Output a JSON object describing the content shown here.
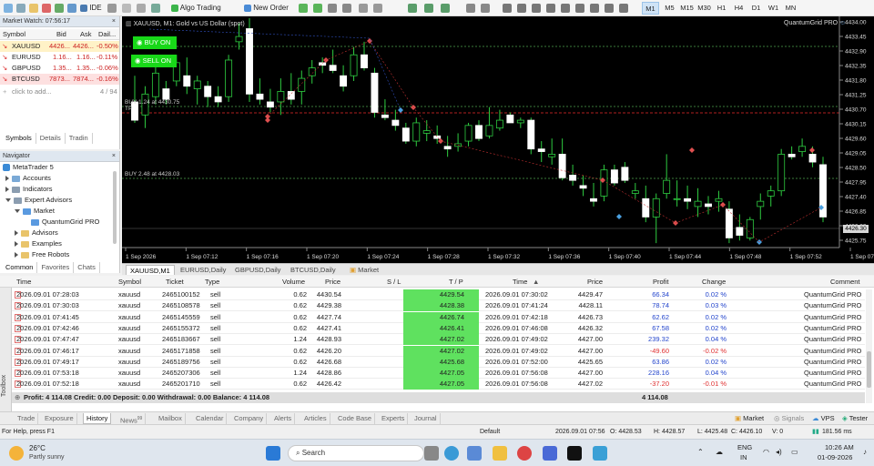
{
  "toolbar": {
    "ide": "IDE",
    "algo": "Algo Trading",
    "new_order": "New Order",
    "timeframes": [
      "M1",
      "M5",
      "M15",
      "M30",
      "H1",
      "H4",
      "D1",
      "W1",
      "MN"
    ],
    "active_tf": "M1"
  },
  "market_watch": {
    "title": "Market Watch: 07:56:17",
    "cols": [
      "Symbol",
      "Bid",
      "Ask",
      "Dail..."
    ],
    "rows": [
      {
        "sym": "XAUUSD",
        "bid": "4426...",
        "ask": "4426...",
        "chg": "-0.50%"
      },
      {
        "sym": "EURUSD",
        "bid": "1.16...",
        "ask": "1.16...",
        "chg": "-0.11%"
      },
      {
        "sym": "GBPUSD",
        "bid": "1.35...",
        "ask": "1.35...",
        "chg": "-0.06%"
      },
      {
        "sym": "BTCUSD",
        "bid": "7873...",
        "ask": "7874...",
        "chg": "-0.16%"
      }
    ],
    "add": "click to add...",
    "count": "4 / 94",
    "tabs": [
      "Symbols",
      "Details",
      "Tradin"
    ]
  },
  "navigator": {
    "title": "Navigator",
    "items": [
      "MetaTrader 5",
      "Accounts",
      "Indicators",
      "Expert Advisors",
      "Market",
      "QuantumGrid PRO",
      "Advisors",
      "Examples",
      "Free Robots"
    ],
    "tabs": [
      "Common",
      "Favorites",
      "Chats"
    ]
  },
  "chart": {
    "title": "XAUUSD, M1:  Gold vs US Dollar (spot)",
    "ea": "QuantumGrid PRO",
    "buy_on": "BUY ON",
    "sell_on": "SELL ON",
    "line_buy1": "BUY 1.24 at 4430.75",
    "line_tp": "TP",
    "line_buy2": "BUY 2.48 at 4428.03",
    "price_tag": "4426.30",
    "yticks": [
      "4434.00",
      "4433.45",
      "4432.90",
      "4432.35",
      "4431.80",
      "4431.25",
      "4430.70",
      "4430.15",
      "4429.60",
      "4429.05",
      "4428.50",
      "4427.95",
      "4427.40",
      "4426.85",
      "4426.30",
      "4425.75"
    ],
    "xticks": [
      "1 Sep 2026",
      "1 Sep 07:12",
      "1 Sep 07:16",
      "1 Sep 07:20",
      "1 Sep 07:24",
      "1 Sep 07:28",
      "1 Sep 07:32",
      "1 Sep 07:36",
      "1 Sep 07:40",
      "1 Sep 07:44",
      "1 Sep 07:48",
      "1 Sep 07:52",
      "1 Sep 07:56"
    ],
    "tabs": [
      "XAUUSD,M1",
      "EURUSD,Daily",
      "GBPUSD,Daily",
      "BTCUSD,Daily",
      "Market"
    ]
  },
  "chart_data": {
    "type": "candlestick",
    "ylim": [
      4425.5,
      4434.2
    ],
    "candles": [
      [
        4431.0,
        4432.0,
        4430.2,
        4430.3
      ],
      [
        4430.5,
        4431.6,
        4430.0,
        4431.3
      ],
      [
        4431.2,
        4432.5,
        4430.9,
        4432.1
      ],
      [
        4431.5,
        4431.8,
        4430.9,
        4431.1
      ],
      [
        4431.8,
        4432.8,
        4431.6,
        4432.5
      ],
      [
        4432.0,
        4432.7,
        4431.3,
        4431.6
      ],
      [
        4431.5,
        4432.0,
        4430.9,
        4431.8
      ],
      [
        4431.6,
        4431.8,
        4430.8,
        4431.2
      ],
      [
        4431.2,
        4431.6,
        4430.8,
        4431.0
      ],
      [
        4431.2,
        4432.8,
        4431.0,
        4432.6
      ],
      [
        4433.3,
        4434.0,
        4433.0,
        4433.5
      ],
      [
        4433.8,
        4434.2,
        4431.0,
        4431.3
      ],
      [
        4431.3,
        4431.9,
        4430.9,
        4431.1
      ],
      [
        4431.0,
        4431.5,
        4430.6,
        4430.8
      ],
      [
        4431.0,
        4431.9,
        4430.5,
        4431.4
      ],
      [
        4431.4,
        4432.1,
        4430.9,
        4431.1
      ],
      [
        4431.4,
        4432.2,
        4430.9,
        4431.9
      ],
      [
        4432.0,
        4432.6,
        4431.7,
        4432.3
      ],
      [
        4432.5,
        4432.7,
        4432.1,
        4432.4
      ],
      [
        4432.4,
        4433.0,
        4432.1,
        4432.2
      ],
      [
        4432.0,
        4432.4,
        4431.4,
        4431.6
      ],
      [
        4432.0,
        4433.1,
        4431.8,
        4432.8
      ],
      [
        4432.8,
        4433.3,
        4432.2,
        4432.3
      ],
      [
        4432.1,
        4432.3,
        4430.4,
        4430.6
      ],
      [
        4430.5,
        4431.1,
        4430.3,
        4430.4
      ],
      [
        4430.3,
        4430.7,
        4429.9,
        4430.1
      ],
      [
        4430.0,
        4430.2,
        4429.4,
        4429.5
      ],
      [
        4429.5,
        4430.4,
        4429.3,
        4430.2
      ],
      [
        4429.8,
        4430.3,
        4429.5,
        4429.9
      ],
      [
        4429.7,
        4430.1,
        4429.4,
        4429.6
      ],
      [
        4429.3,
        4429.7,
        4428.9,
        4429.2
      ],
      [
        4429.3,
        4429.8,
        4429.1,
        4429.4
      ],
      [
        4429.5,
        4430.2,
        4429.3,
        4430.1
      ],
      [
        4430.1,
        4430.3,
        4429.5,
        4429.6
      ],
      [
        4429.7,
        4430.8,
        4429.6,
        4430.1
      ],
      [
        4430.0,
        4430.7,
        4429.9,
        4430.3
      ],
      [
        4430.5,
        4430.6,
        4430.2,
        4430.2
      ],
      [
        4430.2,
        4430.4,
        4430.0,
        4430.3
      ],
      [
        4430.3,
        4430.4,
        4429.0,
        4429.2
      ],
      [
        4429.2,
        4429.5,
        4428.7,
        4429.1
      ],
      [
        4428.9,
        4429.6,
        4428.6,
        4429.0
      ],
      [
        4429.0,
        4429.6,
        4428.0,
        4428.1
      ],
      [
        4428.2,
        4428.6,
        4427.8,
        4428.0
      ],
      [
        4427.8,
        4428.2,
        4427.4,
        4427.7
      ],
      [
        4427.3,
        4427.9,
        4427.0,
        4427.2
      ],
      [
        4427.4,
        4428.6,
        4427.2,
        4428.4
      ],
      [
        4428.4,
        4428.6,
        4427.8,
        4427.9
      ],
      [
        4428.5,
        4428.7,
        4427.9,
        4428.0
      ],
      [
        4427.5,
        4427.9,
        4427.3,
        4427.6
      ],
      [
        4427.3,
        4427.8,
        4426.4,
        4426.6
      ],
      [
        4426.6,
        4427.5,
        4425.6,
        4427.3
      ],
      [
        4427.5,
        4429.0,
        4427.3,
        4428.0
      ],
      [
        4427.3,
        4428.0,
        4427.0,
        4427.3
      ],
      [
        4427.3,
        4427.8,
        4426.9,
        4427.2
      ],
      [
        4427.0,
        4427.7,
        4426.6,
        4427.2
      ],
      [
        4427.1,
        4427.4,
        4426.7,
        4427.0
      ],
      [
        4427.2,
        4427.6,
        4426.8,
        4427.3
      ],
      [
        4426.9,
        4427.2,
        4425.6,
        4425.8
      ],
      [
        4426.2,
        4426.7,
        4425.7,
        4425.9
      ],
      [
        4425.8,
        4426.6,
        4425.7,
        4426.5
      ],
      [
        4427.0,
        4427.5,
        4426.5,
        4427.2
      ],
      [
        4427.4,
        4427.8,
        4427.0,
        4427.6
      ],
      [
        4427.6,
        4429.2,
        4427.4,
        4429.0
      ],
      [
        4429.0,
        4429.3,
        4428.8,
        4428.9
      ],
      [
        4429.1,
        4429.6,
        4428.9,
        4429.3
      ],
      [
        4429.0,
        4429.3,
        4428.5,
        4428.7
      ],
      [
        4428.6,
        4428.9,
        4426.4,
        4426.6
      ]
    ]
  },
  "trade_table": {
    "headers": [
      "Time",
      "Symbol",
      "Ticket",
      "Type",
      "Volume",
      "Price",
      "S / L",
      "T / P",
      "Time",
      "Price",
      "Profit",
      "Change",
      "Comment"
    ],
    "rows": [
      [
        "2026.09.01 07:28:03",
        "xauusd",
        "2465100152",
        "sell",
        "0.62",
        "4430.54",
        "",
        "4429.54",
        "2026.09.01 07:30:02",
        "4429.47",
        "66.34",
        "0.02 %",
        "QuantumGrid PRO"
      ],
      [
        "2026.09.01 07:30:03",
        "xauusd",
        "2465108578",
        "sell",
        "0.62",
        "4429.38",
        "",
        "4428.38",
        "2026.09.01 07:41:24",
        "4428.11",
        "78.74",
        "0.03 %",
        "QuantumGrid PRO"
      ],
      [
        "2026.09.01 07:41:45",
        "xauusd",
        "2465145559",
        "sell",
        "0.62",
        "4427.74",
        "",
        "4426.74",
        "2026.09.01 07:42:18",
        "4426.73",
        "62.62",
        "0.02 %",
        "QuantumGrid PRO"
      ],
      [
        "2026.09.01 07:42:46",
        "xauusd",
        "2465155372",
        "sell",
        "0.62",
        "4427.41",
        "",
        "4426.41",
        "2026.09.01 07:46:08",
        "4426.32",
        "67.58",
        "0.02 %",
        "QuantumGrid PRO"
      ],
      [
        "2026.09.01 07:47:47",
        "xauusd",
        "2465183667",
        "sell",
        "1.24",
        "4428.93",
        "",
        "4427.02",
        "2026.09.01 07:49:02",
        "4427.00",
        "239.32",
        "0.04 %",
        "QuantumGrid PRO"
      ],
      [
        "2026.09.01 07:46:17",
        "xauusd",
        "2465171858",
        "sell",
        "0.62",
        "4426.20",
        "",
        "4427.02",
        "2026.09.01 07:49:02",
        "4427.00",
        "-49.60",
        "-0.02 %",
        "QuantumGrid PRO"
      ],
      [
        "2026.09.01 07:49:17",
        "xauusd",
        "2465189756",
        "sell",
        "0.62",
        "4426.68",
        "",
        "4425.68",
        "2026.09.01 07:52:00",
        "4425.65",
        "63.86",
        "0.02 %",
        "QuantumGrid PRO"
      ],
      [
        "2026.09.01 07:53:18",
        "xauusd",
        "2465207306",
        "sell",
        "1.24",
        "4428.86",
        "",
        "4427.05",
        "2026.09.01 07:56:08",
        "4427.00",
        "228.16",
        "0.04 %",
        "QuantumGrid PRO"
      ],
      [
        "2026.09.01 07:52:18",
        "xauusd",
        "2465201710",
        "sell",
        "0.62",
        "4426.42",
        "",
        "4427.05",
        "2026.09.01 07:56:08",
        "4427.02",
        "-37.20",
        "-0.01 %",
        "QuantumGrid PRO"
      ]
    ],
    "summary": "Profit: 4 114.08   Credit: 0.00   Deposit: 0.00   Withdrawal: 0.00   Balance: 4 114.08",
    "summary_total": "4 114.08"
  },
  "bottom_tabs": [
    "Trade",
    "Exposure",
    "History",
    "News",
    "Mailbox",
    "Calendar",
    "Company",
    "Alerts",
    "Articles",
    "Code Base",
    "Experts",
    "Journal"
  ],
  "bottom_right": {
    "market": "Market",
    "signals": "Signals",
    "vps": "VPS",
    "tester": "Tester"
  },
  "toolbox_label": "Toolbox",
  "status": {
    "help": "For Help, press F1",
    "profile": "Default",
    "time": "2026.09.01 07:56",
    "o": "O: 4428.53",
    "h": "H: 4428.57",
    "l": "L: 4425.48",
    "c": "C: 4426.10",
    "v": "V: 0",
    "ping": "181.56 ms"
  },
  "taskbar": {
    "temp": "26°C",
    "weather": "Partly sunny",
    "search": "Search",
    "lang1": "ENG",
    "lang2": "IN",
    "clock": "10:26 AM",
    "date": "01-09-2026"
  }
}
